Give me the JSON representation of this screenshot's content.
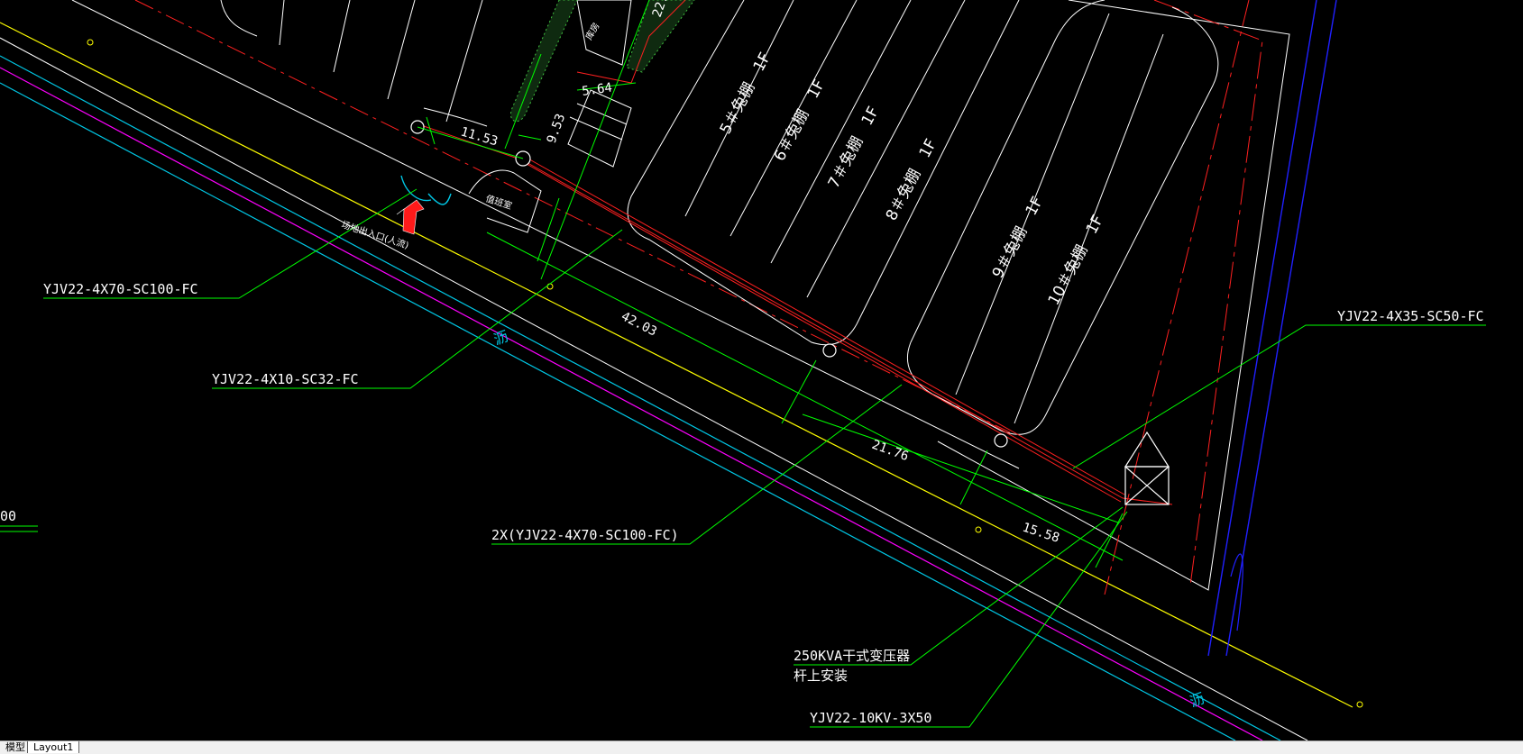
{
  "cable_labels": {
    "c1": "YJV22-4X70-SC100-FC",
    "c2": "YJV22-4X10-SC32-FC",
    "c3": "YJV22-4X35-SC50-FC",
    "c4": "2X(YJV22-4X70-SC100-FC)",
    "c5": "YJV22-10KV-3X50"
  },
  "transformer": {
    "line1": "250KVA干式变压器",
    "line2": "杆上安装"
  },
  "dimensions": {
    "d1": "11.53",
    "d2": "9.53",
    "d3": "5.64",
    "d4": "42.03",
    "d5": "21.76",
    "d6": "15.58",
    "d7": "22."
  },
  "rooms": {
    "r5": "5＃兔棚　1F",
    "r6": "6＃兔棚　1F",
    "r7": "7＃兔棚　1F",
    "r8": "8＃兔棚　1F",
    "r9": "9＃兔棚　1F",
    "r10": "10＃兔棚　1F"
  },
  "small_texts": {
    "guard": "值班室",
    "top": "库房",
    "entrance": "场地出入口(人流)"
  },
  "asphalt": "沥",
  "left_fragment": "00",
  "tabs": {
    "model": "模型",
    "layout1": "Layout1"
  }
}
